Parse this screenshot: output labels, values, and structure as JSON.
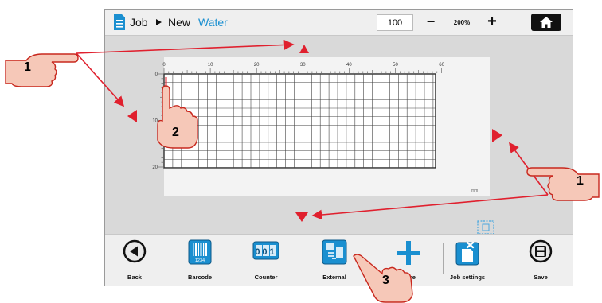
{
  "header": {
    "job_label": "Job",
    "new_label": "New",
    "job_name": "Water",
    "zoom_value": "100",
    "zoom_out_label": "−",
    "zoom_level": "200%",
    "zoom_in_label": "+"
  },
  "canvas": {
    "x_ticks": [
      "0",
      "10",
      "20",
      "30",
      "40",
      "50",
      "60"
    ],
    "y_ticks": [
      "0",
      "10",
      "20"
    ],
    "unit": "mm"
  },
  "toolbar": {
    "back": "Back",
    "barcode": "Barcode",
    "barcode_digits": "1234",
    "counter": "Counter",
    "counter_digits": "001",
    "external": "External",
    "more": "More",
    "job_settings": "Job settings",
    "save": "Save"
  },
  "callouts": {
    "scroll_marker": "1",
    "cursor_marker": "2",
    "external_marker": "3"
  },
  "colors": {
    "accent_blue": "#1a8fd0",
    "arrow_red": "#e0202e",
    "hand_fill": "#f6c8b8",
    "hand_stroke": "#c8281e"
  },
  "icons": {
    "home": "home-icon",
    "back": "back-arrow-icon",
    "save": "floppy-icon",
    "job": "document-icon"
  }
}
